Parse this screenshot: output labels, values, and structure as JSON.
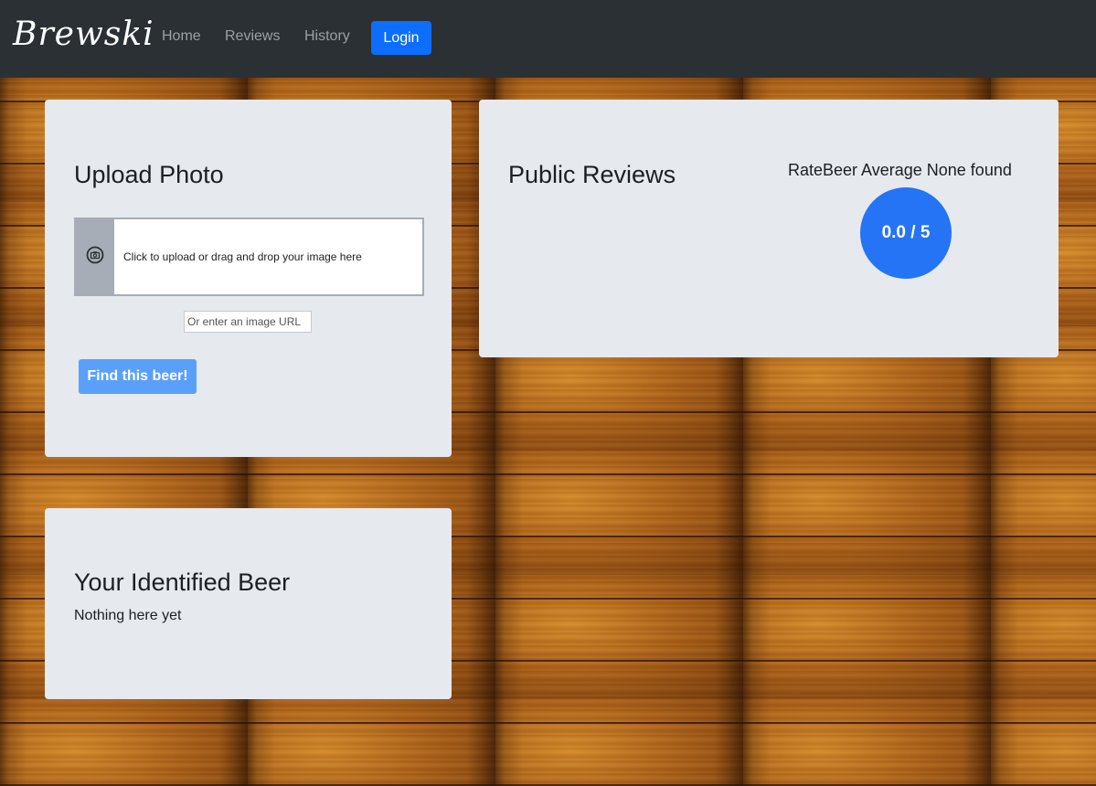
{
  "navbar": {
    "brand": "Brewski",
    "links": [
      {
        "label": "Home"
      },
      {
        "label": "Reviews"
      },
      {
        "label": "History"
      }
    ],
    "login_label": "Login"
  },
  "upload": {
    "title": "Upload Photo",
    "dropzone_text": "Click to upload or drag and drop your image here",
    "dropzone_icon": "camera-icon",
    "url_placeholder": "Or enter an image URL",
    "find_button": "Find this beer!"
  },
  "reviews": {
    "title": "Public Reviews",
    "ratebeer_label": "RateBeer Average None found",
    "rating_display": "0.0 / 5"
  },
  "identified": {
    "title": "Your Identified Beer",
    "message": "Nothing here yet"
  },
  "colors": {
    "navbar_bg": "#2b3035",
    "primary": "#0d6efd",
    "find_button": "#5aa0fb",
    "rating_circle": "#2574f5",
    "card_bg": "#e6e9ee"
  }
}
